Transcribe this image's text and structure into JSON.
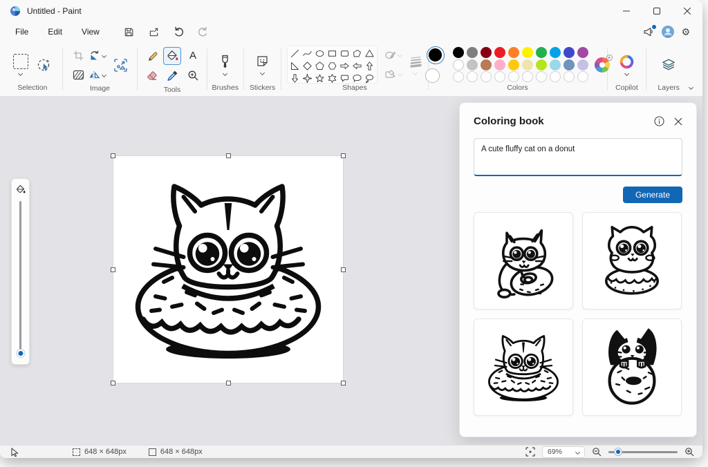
{
  "accent_color": "#1267b5",
  "window": {
    "title": "Untitled - Paint"
  },
  "menubar": {
    "items": [
      "File",
      "Edit",
      "View"
    ]
  },
  "ribbon": {
    "groups": {
      "selection": {
        "label": "Selection"
      },
      "image": {
        "label": "Image"
      },
      "tools": {
        "label": "Tools",
        "text_tool_glyph": "A"
      },
      "brushes": {
        "label": "Brushes"
      },
      "stickers": {
        "label": "Stickers"
      },
      "shapes": {
        "label": "Shapes",
        "items": [
          "line",
          "curve",
          "oval",
          "rectangle",
          "rounded-rectangle",
          "polygon",
          "triangle",
          "right-triangle",
          "diamond",
          "pentagon",
          "hexagon",
          "arrow-right",
          "arrow-left",
          "arrow-up",
          "arrow-down",
          "star-four",
          "star-five",
          "star-six",
          "speech-bubble",
          "oval-speech",
          "thought-bubble",
          "heart",
          "lightning"
        ]
      },
      "colors": {
        "label": "Colors",
        "foreground": "#000000",
        "background": "#ffffff",
        "row1": [
          "#000000",
          "#7f7f7f",
          "#880015",
          "#ed1c24",
          "#ff7f27",
          "#fff200",
          "#22b14c",
          "#00a2e8",
          "#3f48cc",
          "#a349a4"
        ],
        "row2": [
          "#ffffff",
          "#c3c3c3",
          "#b97a57",
          "#ffaec9",
          "#ffc90e",
          "#efe4b0",
          "#b5e61d",
          "#99d9ea",
          "#7092be",
          "#c8bfe7"
        ],
        "empty_slots": 10
      },
      "copilot": {
        "label": "Copilot"
      },
      "layers": {
        "label": "Layers"
      }
    }
  },
  "coloring_book": {
    "title": "Coloring book",
    "prompt": "A cute fluffy cat on a donut",
    "generate_label": "Generate",
    "thumbnails": [
      "cat hugging donut",
      "fluffy cat on donut",
      "cat head in donut",
      "tuxedo cat behind donut"
    ]
  },
  "canvas": {
    "content": "cat head in donut line art",
    "selected": true
  },
  "status_bar": {
    "selection_size": "648 × 648px",
    "canvas_size": "648 × 648px",
    "zoom_level": "69%"
  }
}
